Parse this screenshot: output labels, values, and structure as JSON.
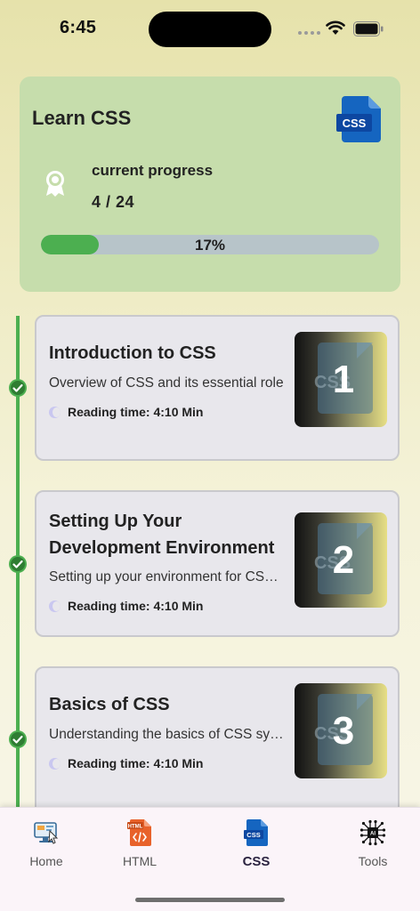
{
  "status_bar": {
    "time": "6:45"
  },
  "header": {
    "course_title": "Learn CSS",
    "course_icon": "css-file-icon",
    "progress_label": "current progress",
    "progress_count": "4 / 24",
    "progress_percent_label": "17%",
    "progress_fraction": 0.17,
    "accent_color": "#4caf50"
  },
  "lessons": [
    {
      "number": "1",
      "title": "Introduction to CSS",
      "description": "Overview of CSS and its essential role",
      "reading_time": "Reading time: 4:10 Min",
      "completed": true
    },
    {
      "number": "2",
      "title": "Setting Up Your Development Environment",
      "description": "Setting up your environment for CSS development",
      "reading_time": "Reading time: 4:10 Min",
      "completed": true
    },
    {
      "number": "3",
      "title": "Basics of CSS",
      "description": "Understanding the basics of CSS syntax",
      "reading_time": "Reading time: 4:10 Min",
      "completed": true
    }
  ],
  "thumb_label": "CSS",
  "tabs": [
    {
      "label": "Home",
      "icon": "home-computer-icon",
      "active": false
    },
    {
      "label": "HTML",
      "icon": "html-file-icon",
      "active": false
    },
    {
      "label": "CSS",
      "icon": "css-file-icon",
      "active": true
    },
    {
      "label": "Tools",
      "icon": "ai-chip-icon",
      "active": false
    }
  ]
}
